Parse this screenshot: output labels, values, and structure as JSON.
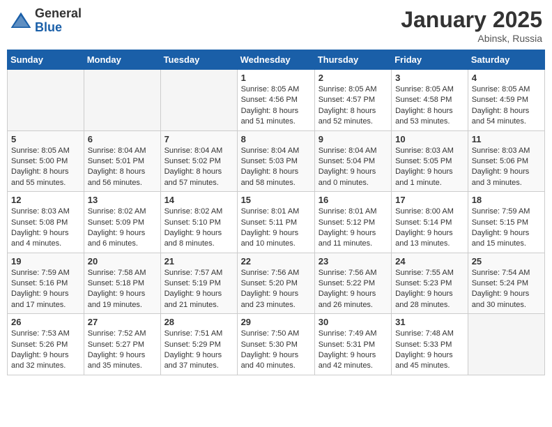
{
  "header": {
    "logo_general": "General",
    "logo_blue": "Blue",
    "month_title": "January 2025",
    "location": "Abinsk, Russia"
  },
  "weekdays": [
    "Sunday",
    "Monday",
    "Tuesday",
    "Wednesday",
    "Thursday",
    "Friday",
    "Saturday"
  ],
  "weeks": [
    [
      {
        "day": "",
        "info": ""
      },
      {
        "day": "",
        "info": ""
      },
      {
        "day": "",
        "info": ""
      },
      {
        "day": "1",
        "info": "Sunrise: 8:05 AM\nSunset: 4:56 PM\nDaylight: 8 hours\nand 51 minutes."
      },
      {
        "day": "2",
        "info": "Sunrise: 8:05 AM\nSunset: 4:57 PM\nDaylight: 8 hours\nand 52 minutes."
      },
      {
        "day": "3",
        "info": "Sunrise: 8:05 AM\nSunset: 4:58 PM\nDaylight: 8 hours\nand 53 minutes."
      },
      {
        "day": "4",
        "info": "Sunrise: 8:05 AM\nSunset: 4:59 PM\nDaylight: 8 hours\nand 54 minutes."
      }
    ],
    [
      {
        "day": "5",
        "info": "Sunrise: 8:05 AM\nSunset: 5:00 PM\nDaylight: 8 hours\nand 55 minutes."
      },
      {
        "day": "6",
        "info": "Sunrise: 8:04 AM\nSunset: 5:01 PM\nDaylight: 8 hours\nand 56 minutes."
      },
      {
        "day": "7",
        "info": "Sunrise: 8:04 AM\nSunset: 5:02 PM\nDaylight: 8 hours\nand 57 minutes."
      },
      {
        "day": "8",
        "info": "Sunrise: 8:04 AM\nSunset: 5:03 PM\nDaylight: 8 hours\nand 58 minutes."
      },
      {
        "day": "9",
        "info": "Sunrise: 8:04 AM\nSunset: 5:04 PM\nDaylight: 9 hours\nand 0 minutes."
      },
      {
        "day": "10",
        "info": "Sunrise: 8:03 AM\nSunset: 5:05 PM\nDaylight: 9 hours\nand 1 minute."
      },
      {
        "day": "11",
        "info": "Sunrise: 8:03 AM\nSunset: 5:06 PM\nDaylight: 9 hours\nand 3 minutes."
      }
    ],
    [
      {
        "day": "12",
        "info": "Sunrise: 8:03 AM\nSunset: 5:08 PM\nDaylight: 9 hours\nand 4 minutes."
      },
      {
        "day": "13",
        "info": "Sunrise: 8:02 AM\nSunset: 5:09 PM\nDaylight: 9 hours\nand 6 minutes."
      },
      {
        "day": "14",
        "info": "Sunrise: 8:02 AM\nSunset: 5:10 PM\nDaylight: 9 hours\nand 8 minutes."
      },
      {
        "day": "15",
        "info": "Sunrise: 8:01 AM\nSunset: 5:11 PM\nDaylight: 9 hours\nand 10 minutes."
      },
      {
        "day": "16",
        "info": "Sunrise: 8:01 AM\nSunset: 5:12 PM\nDaylight: 9 hours\nand 11 minutes."
      },
      {
        "day": "17",
        "info": "Sunrise: 8:00 AM\nSunset: 5:14 PM\nDaylight: 9 hours\nand 13 minutes."
      },
      {
        "day": "18",
        "info": "Sunrise: 7:59 AM\nSunset: 5:15 PM\nDaylight: 9 hours\nand 15 minutes."
      }
    ],
    [
      {
        "day": "19",
        "info": "Sunrise: 7:59 AM\nSunset: 5:16 PM\nDaylight: 9 hours\nand 17 minutes."
      },
      {
        "day": "20",
        "info": "Sunrise: 7:58 AM\nSunset: 5:18 PM\nDaylight: 9 hours\nand 19 minutes."
      },
      {
        "day": "21",
        "info": "Sunrise: 7:57 AM\nSunset: 5:19 PM\nDaylight: 9 hours\nand 21 minutes."
      },
      {
        "day": "22",
        "info": "Sunrise: 7:56 AM\nSunset: 5:20 PM\nDaylight: 9 hours\nand 23 minutes."
      },
      {
        "day": "23",
        "info": "Sunrise: 7:56 AM\nSunset: 5:22 PM\nDaylight: 9 hours\nand 26 minutes."
      },
      {
        "day": "24",
        "info": "Sunrise: 7:55 AM\nSunset: 5:23 PM\nDaylight: 9 hours\nand 28 minutes."
      },
      {
        "day": "25",
        "info": "Sunrise: 7:54 AM\nSunset: 5:24 PM\nDaylight: 9 hours\nand 30 minutes."
      }
    ],
    [
      {
        "day": "26",
        "info": "Sunrise: 7:53 AM\nSunset: 5:26 PM\nDaylight: 9 hours\nand 32 minutes."
      },
      {
        "day": "27",
        "info": "Sunrise: 7:52 AM\nSunset: 5:27 PM\nDaylight: 9 hours\nand 35 minutes."
      },
      {
        "day": "28",
        "info": "Sunrise: 7:51 AM\nSunset: 5:29 PM\nDaylight: 9 hours\nand 37 minutes."
      },
      {
        "day": "29",
        "info": "Sunrise: 7:50 AM\nSunset: 5:30 PM\nDaylight: 9 hours\nand 40 minutes."
      },
      {
        "day": "30",
        "info": "Sunrise: 7:49 AM\nSunset: 5:31 PM\nDaylight: 9 hours\nand 42 minutes."
      },
      {
        "day": "31",
        "info": "Sunrise: 7:48 AM\nSunset: 5:33 PM\nDaylight: 9 hours\nand 45 minutes."
      },
      {
        "day": "",
        "info": ""
      }
    ]
  ]
}
